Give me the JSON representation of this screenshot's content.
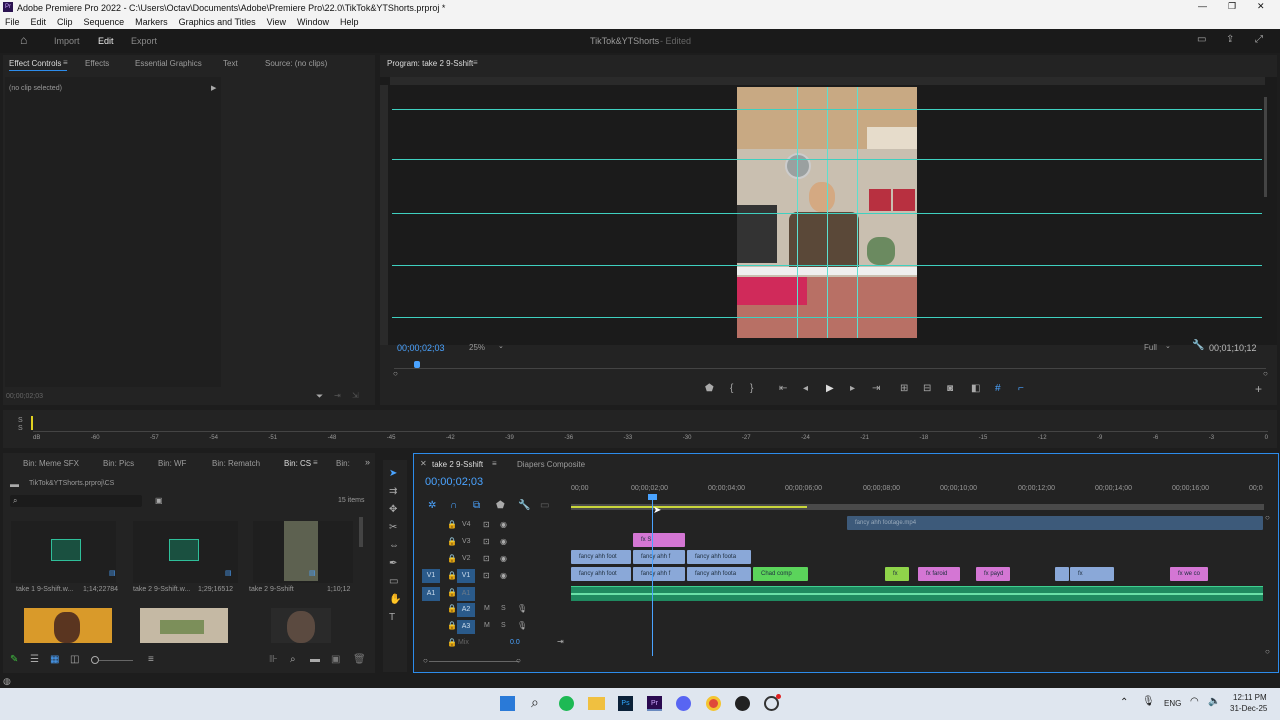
{
  "window": {
    "title": "Adobe Premiere Pro 2022 - C:\\Users\\Octav\\Documents\\Adobe\\Premiere Pro\\22.0\\TikTok&YTShorts.prproj *",
    "min": "—",
    "max": "❐",
    "close": "✕"
  },
  "menu": [
    "File",
    "Edit",
    "Clip",
    "Sequence",
    "Markers",
    "Graphics and Titles",
    "View",
    "Window",
    "Help"
  ],
  "header": {
    "import": "Import",
    "edit": "Edit",
    "export": "Export",
    "project": "TikTok&YTShorts",
    "status": "- Edited"
  },
  "source_panel": {
    "tabs": [
      "Effect Controls",
      "Effects",
      "Essential Graphics",
      "Text",
      "Source: (no clips)"
    ],
    "no_clip": "(no clip selected)",
    "timecode": "00;00;02;03"
  },
  "program": {
    "tab": "Program: take 2 9-Sshift",
    "timecode": "00;00;02;03",
    "zoom": "25%",
    "quality": "Full",
    "duration": "00;01;10;12"
  },
  "audio_meter": {
    "ticks": [
      "dB",
      "-60",
      "-57",
      "-54",
      "-51",
      "-48",
      "-45",
      "-42",
      "-39",
      "-36",
      "-33",
      "-30",
      "-27",
      "-24",
      "-21",
      "-18",
      "-15",
      "-12",
      "-9",
      "-6",
      "-3",
      "0"
    ]
  },
  "bins": {
    "tabs": [
      "Bin: Meme SFX",
      "Bin: Pics",
      "Bin: WF",
      "Bin: Rematch",
      "Bin: CS",
      "Bin:"
    ],
    "path": "TikTok&YTShorts.prproj\\CS",
    "count": "15 items",
    "items": [
      {
        "name": "take 1 9-Sshift.w...",
        "dur": "1;14;22784"
      },
      {
        "name": "take 2 9-Sshift.w...",
        "dur": "1;29;16512"
      },
      {
        "name": "take 2 9-Sshift",
        "dur": "1;10;12"
      }
    ]
  },
  "timeline": {
    "tabs": [
      "take 2 9-Sshift",
      "Diapers Composite"
    ],
    "timecode": "00;00;02;03",
    "ruler": [
      "00;00",
      "00;00;02;00",
      "00;00;04;00",
      "00;00;06;00",
      "00;00;08;00",
      "00;00;10;00",
      "00;00;12;00",
      "00;00;14;00",
      "00;00;16;00",
      "00;0"
    ],
    "tracks": [
      "V4",
      "V3",
      "V2",
      "V1",
      "A1",
      "A2",
      "A3"
    ],
    "v1_src": "V1",
    "a1_src": "A1",
    "mix": "Mix",
    "mix_val": "0.0",
    "clips": {
      "v4": "fancy ahh footage.mp4",
      "v3": "fx S",
      "v2a": "fancy ahh foot",
      "v2b": "fancy ahh f",
      "v2c": "fancy ahh foota",
      "v1a": "fancy ahh foot",
      "v1b": "fancy ahh f",
      "v1c": "fancy ahh foota",
      "v1d": "Chad comp",
      "v1e": "fx",
      "v1f": "fx faroid",
      "v1g": "fx payd",
      "v1h": "fx",
      "v1i": "fx we co"
    }
  },
  "tray": {
    "lang": "ENG",
    "time": "12:11 PM",
    "date": "31-Dec-25"
  }
}
